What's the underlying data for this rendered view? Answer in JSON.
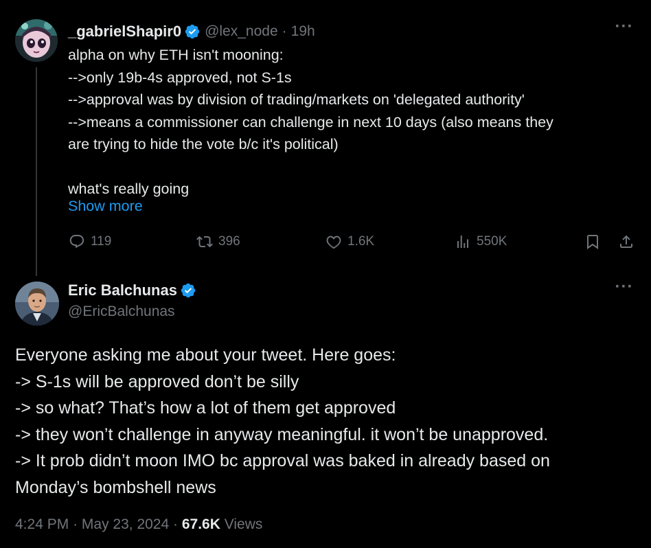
{
  "parent_tweet": {
    "display_name": "_gabrielShapir0",
    "handle": "@lex_node",
    "separator": "·",
    "age": "19h",
    "more_label": "···",
    "lines": [
      "alpha on why ETH isn't mooning:",
      "-->only 19b-4s approved, not S-1s",
      "-->approval was by division of trading/markets on 'delegated authority'",
      "-->means a commissioner can challenge in next 10 days (also means they",
      "are trying to hide the vote b/c it's political)",
      "",
      "what's really going"
    ],
    "show_more": "Show more",
    "actions": {
      "replies": "119",
      "reposts": "396",
      "likes": "1.6K",
      "views": "550K"
    }
  },
  "reply_tweet": {
    "display_name": "Eric Balchunas",
    "handle": "@EricBalchunas",
    "more_label": "···",
    "lines": [
      "Everyone asking me about your tweet. Here goes:",
      "-> S-1s will be approved don’t be silly",
      "-> so what? That’s how a lot of them get approved",
      "-> they won’t challenge in anyway meaningful. it won’t be unapproved.",
      "-> It prob didn’t moon IMO bc approval was baked in already based on",
      "Monday’s bombshell news"
    ],
    "time": "4:24 PM",
    "date": "May 23, 2024",
    "separator": "·",
    "views_count": "67.6K",
    "views_label": "Views"
  },
  "icons": {
    "verified": "verified-badge-icon",
    "reply": "reply-icon",
    "repost": "repost-icon",
    "like": "heart-icon",
    "views": "bar-chart-icon",
    "bookmark": "bookmark-icon",
    "share": "share-icon"
  },
  "colors": {
    "background": "#000000",
    "text": "#e7e9ea",
    "muted": "#71767b",
    "accent": "#1d9bf0"
  }
}
